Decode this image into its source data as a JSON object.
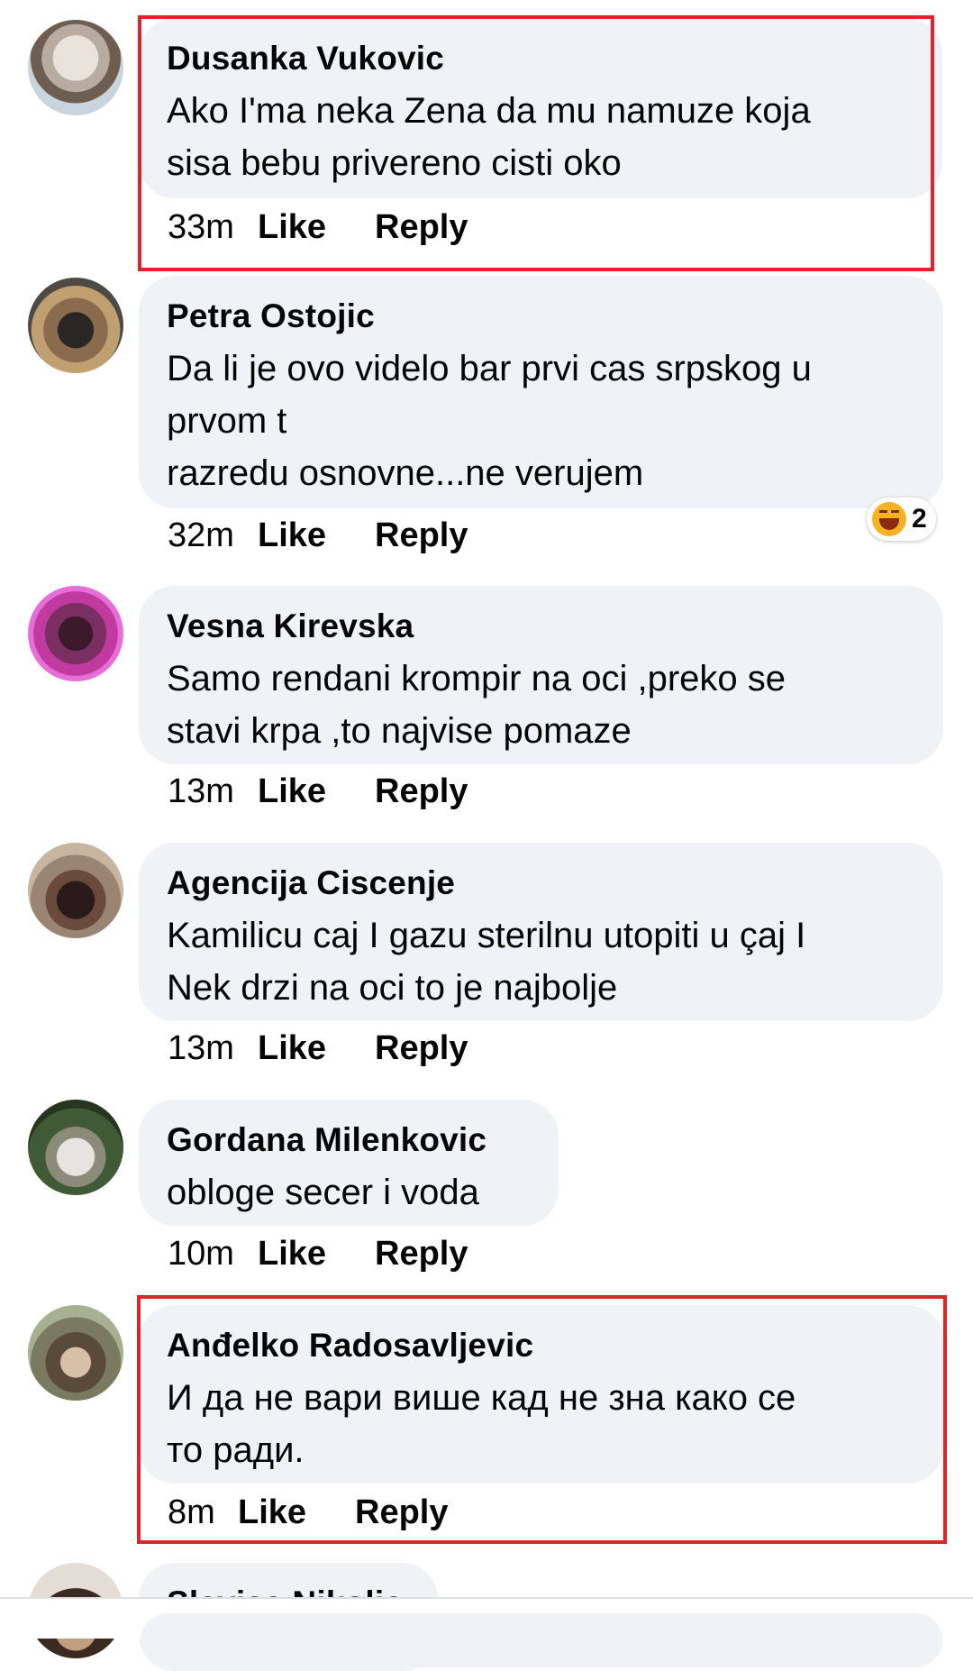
{
  "actions": {
    "like": "Like",
    "reply": "Reply"
  },
  "comments": [
    {
      "name": "Dusanka Vukovic",
      "text": "Ako I'ma neka Zena da mu namuze koja\nsisa bebu privereno cisti oko",
      "time": "33m",
      "highlighted": true
    },
    {
      "name": "Petra Ostojic",
      "text": "Da li je ovo videlo bar prvi cas srpskog u\nprvom t\nrazredu osnovne...ne verujem",
      "time": "32m",
      "reaction": {
        "icon": "laughing-emoji-icon",
        "count": "2"
      }
    },
    {
      "name": "Vesna Kirevska",
      "text": "Samo rendani krompir na oci ,preko se\nstavi krpa ,to najvise pomaze",
      "time": "13m"
    },
    {
      "name": "Agencija Ciscenje",
      "text": "Kamilicu caj I gazu sterilnu utopiti u çaj I\nNek drzi na oci to je najbolje",
      "time": "13m"
    },
    {
      "name": "Gordana Milenkovic",
      "text": "obloge secer i voda",
      "time": "10m"
    },
    {
      "name": "Anđelko Radosavljevic",
      "text": "И да не вари више кад не зна како се\nто ради.",
      "time": "8m",
      "highlighted": true
    },
    {
      "name": "Slavisa Nikolic"
    }
  ],
  "colors": {
    "bubble": "#f0f2f5",
    "highlight": "#e0222b",
    "text": "#050505"
  }
}
